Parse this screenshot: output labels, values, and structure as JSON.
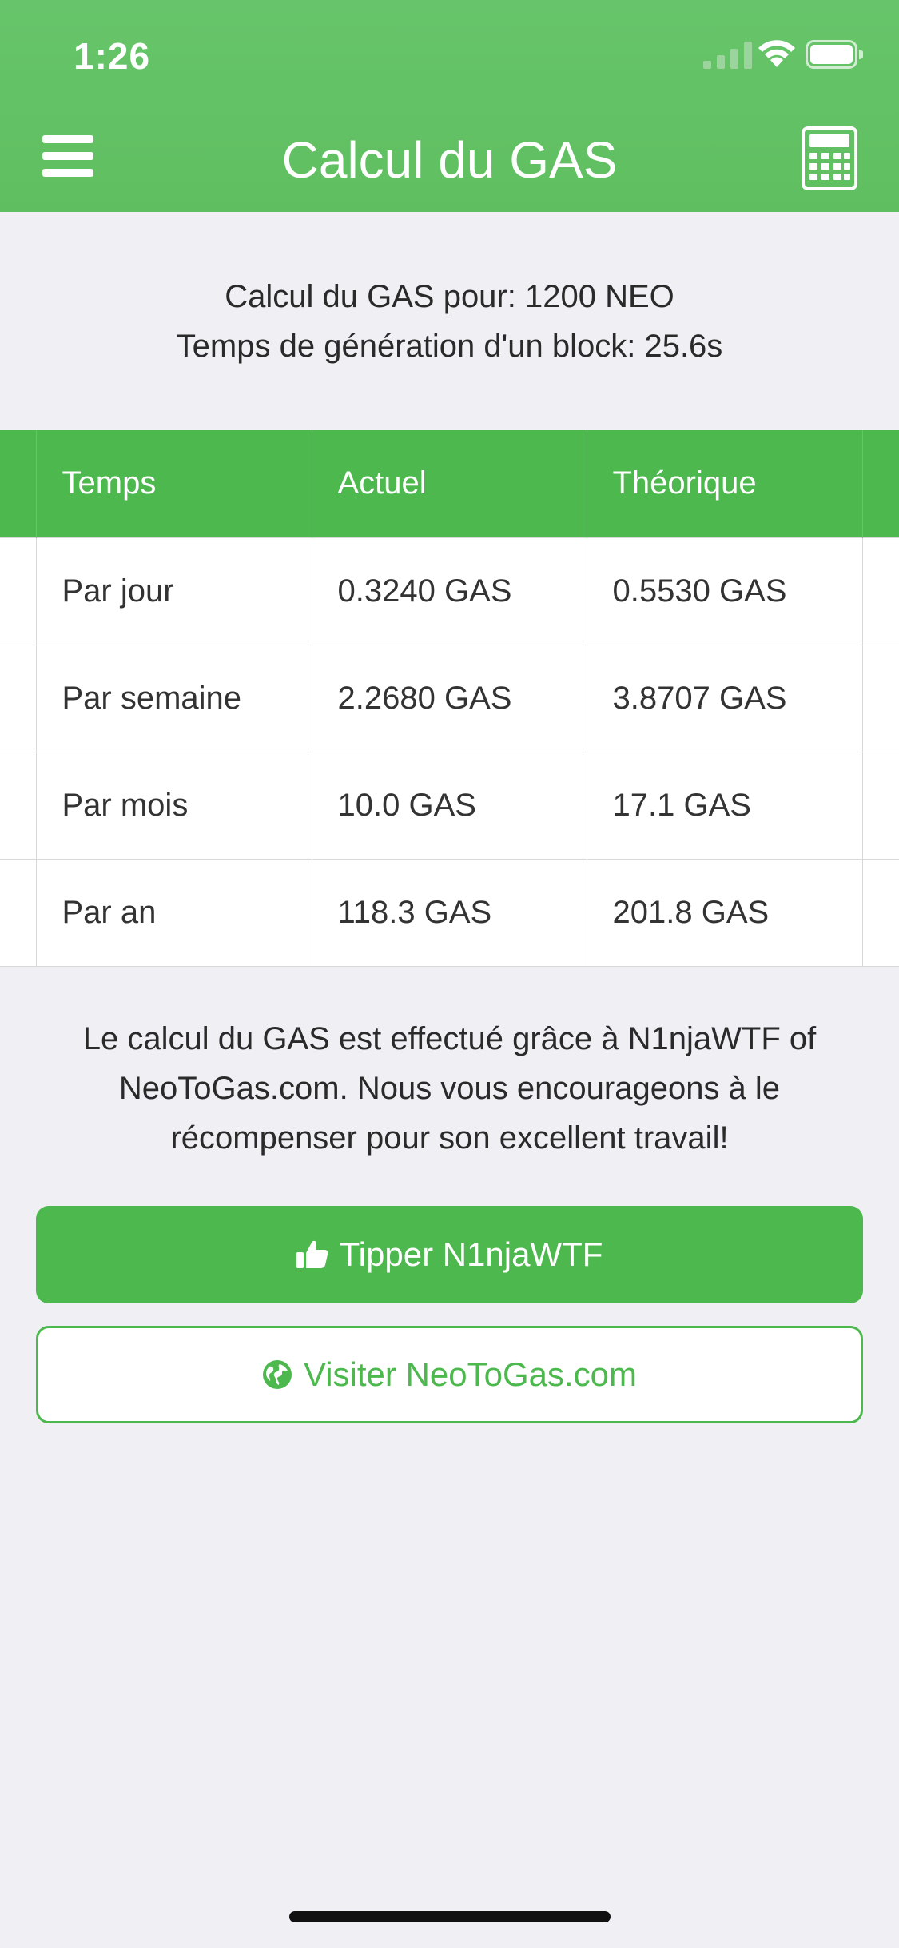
{
  "status_bar": {
    "time": "1:26"
  },
  "nav": {
    "title": "Calcul du GAS",
    "left_icon": "menu-icon",
    "right_icon": "calculator-icon"
  },
  "info": {
    "line1": "Calcul du GAS pour: 1200 NEO",
    "line2": "Temps de génération d'un block: 25.6s"
  },
  "table": {
    "headers": [
      "Temps",
      "Actuel",
      "Théorique"
    ],
    "rows": [
      [
        "Par jour",
        "0.3240 GAS",
        "0.5530 GAS"
      ],
      [
        "Par semaine",
        "2.2680 GAS",
        "3.8707 GAS"
      ],
      [
        "Par mois",
        "10.0 GAS",
        "17.1 GAS"
      ],
      [
        "Par an",
        "118.3 GAS",
        "201.8 GAS"
      ]
    ]
  },
  "credit": {
    "line1": "Le calcul du GAS est effectué grâce à N1njaWTF of",
    "line2": "NeoToGas.com. Nous vous encourageons à le",
    "line3": "récompenser pour son excellent travail!"
  },
  "buttons": {
    "tip_label": "Tipper N1njaWTF",
    "tip_icon": "thumbs-up-icon",
    "visit_label": "Visiter NeoToGas.com",
    "visit_icon": "globe-icon"
  },
  "colors": {
    "header": "#62c264",
    "accent": "#4db84d",
    "background": "#efeff4"
  }
}
